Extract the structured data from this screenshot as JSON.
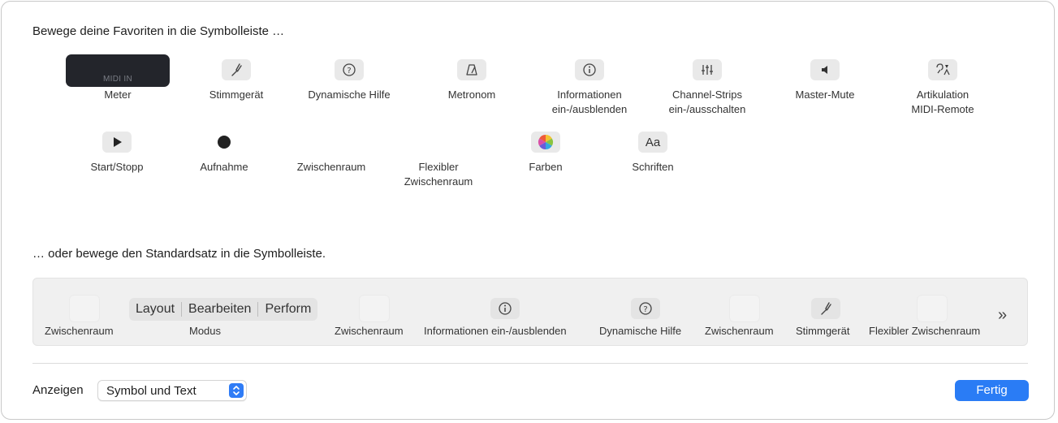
{
  "favorites_heading": "Bewege deine Favoriten in die Symbolleiste …",
  "palette": {
    "meter": {
      "display_text": "MIDI IN",
      "label": "Meter"
    },
    "tuner": {
      "label": "Stimmgerät",
      "icon": "tuning-fork-icon"
    },
    "quick_help": {
      "label": "Dynamische Hilfe",
      "icon": "question-circle-icon"
    },
    "metronome": {
      "label": "Metronom",
      "icon": "metronome-icon"
    },
    "info": {
      "label_line1": "Informationen",
      "label_line2": "ein-/ausblenden",
      "icon": "info-circle-icon"
    },
    "channel_strips": {
      "label_line1": "Channel-Strips",
      "label_line2": "ein-/ausschalten",
      "icon": "sliders-icon"
    },
    "master_mute": {
      "label": "Master-Mute",
      "icon": "speaker-icon"
    },
    "articulation": {
      "label_line1": "Artikulation",
      "label_line2": "MIDI-Remote",
      "icon": "articulation-icon"
    },
    "play_stop": {
      "label": "Start/Stopp",
      "icon": "play-icon"
    },
    "record": {
      "label": "Aufnahme",
      "icon": "record-icon"
    },
    "space": {
      "label": "Zwischenraum"
    },
    "flexible_space": {
      "label_line1": "Flexibler",
      "label_line2": "Zwischenraum"
    },
    "colors": {
      "label": "Farben",
      "icon": "color-wheel-icon"
    },
    "fonts": {
      "label": "Schriften",
      "icon_text": "Aa"
    }
  },
  "default_heading": "… oder bewege den Standardsatz in die Symbolleiste.",
  "default_set": {
    "space1": "Zwischenraum",
    "mode": {
      "segments": [
        "Layout",
        "Bearbeiten",
        "Perform"
      ],
      "label": "Modus"
    },
    "space2": "Zwischenraum",
    "info": "Informationen ein-/ausblenden",
    "quick_help": "Dynamische Hilfe",
    "space3": "Zwischenraum",
    "tuner": "Stimmgerät",
    "flexible_space": "Flexibler Zwischenraum",
    "overflow": "»"
  },
  "footer": {
    "show_label": "Anzeigen",
    "show_value": "Symbol und Text",
    "done_label": "Fertig"
  },
  "colors": {
    "accent": "#2a7cf5",
    "meter_bg": "#23252b"
  }
}
